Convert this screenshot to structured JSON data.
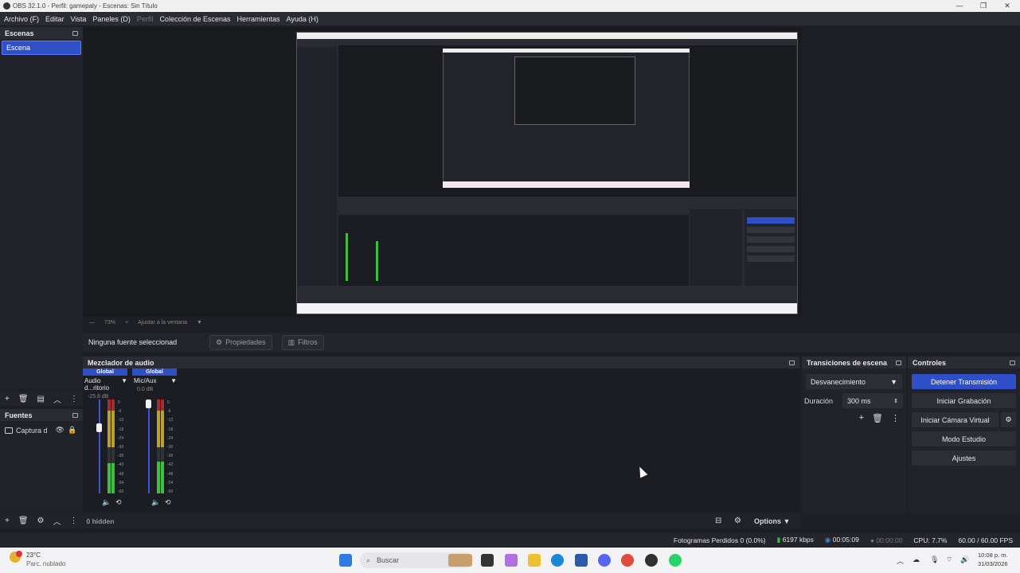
{
  "window": {
    "title": "OBS 32.1.0 - Perfil: gamepaly - Escenas: Sin Título"
  },
  "menu": [
    "Archivo (F)",
    "Editar",
    "Vista",
    "Paneles (D)",
    "Perfil",
    "Colección de Escenas",
    "Herramientas",
    "Ayuda (H)"
  ],
  "scenes": {
    "title": "Escenas",
    "items": [
      "Escena"
    ]
  },
  "sources": {
    "title": "Fuentes",
    "items": [
      {
        "label": "Captura d"
      }
    ]
  },
  "zoom": {
    "value": "73%",
    "fit_label": "Ajustar a la ventana"
  },
  "context": {
    "no_source": "Ninguna fuente seleccionad",
    "properties": "Propiedades",
    "filters": "Filtros"
  },
  "mixer": {
    "title": "Mezclador de audio",
    "hidden_label": "0 hidden",
    "options_label": "Options",
    "channels": [
      {
        "badge": "Global",
        "name": "Audio d...ritorio",
        "db": "-25.8 dB",
        "level": 0.32,
        "volume": 0.72
      },
      {
        "badge": "Global",
        "name": "Mic/Aux",
        "db": "0.0 dB",
        "level": 0.34,
        "volume": 1.0
      }
    ],
    "ticks": [
      "0",
      "-6",
      "-12",
      "-18",
      "-24",
      "-30",
      "-36",
      "-42",
      "-48",
      "-54",
      "-60"
    ]
  },
  "transitions": {
    "title": "Transiciones de escena",
    "selected": "Desvanecimiento",
    "duration_label": "Duración",
    "duration_value": "300 ms"
  },
  "controls": {
    "title": "Controles",
    "stop_stream": "Detener Transmisión",
    "start_record": "Iniciar Grabación",
    "virtual_cam": "Iniciar Cámara Virtual",
    "studio_mode": "Modo Estudio",
    "settings": "Ajustes"
  },
  "status": {
    "dropped": "Fotogramas Perdidos 0 (0.0%)",
    "bitrate": "6197 kbps",
    "stream_time": "00:05:09",
    "rec_time": "00:00:00",
    "cpu": "CPU: 7.7%",
    "fps": "60.00 / 60.00 FPS"
  },
  "taskbar": {
    "weather_temp": "23°C",
    "weather_desc": "Parc. nublado",
    "search_placeholder": "Buscar",
    "time": "10:08 p. m.",
    "date": "31/03/2026"
  }
}
